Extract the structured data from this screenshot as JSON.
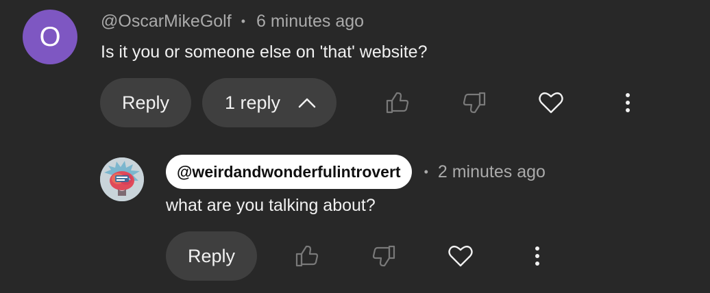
{
  "comment": {
    "avatar_letter": "O",
    "avatar_color": "#7e57c2",
    "author": "@OscarMikeGolf",
    "separator": "•",
    "time": "6 minutes ago",
    "text": "Is it you or someone else on 'that' website?",
    "reply_button_label": "Reply",
    "replies_toggle_label": "1 reply",
    "replies_toggle_icon": "chevron-up-icon",
    "like_icon": "thumbs-up-icon",
    "dislike_icon": "thumbs-down-icon",
    "heart_icon": "heart-icon",
    "more_icon": "more-vert-icon"
  },
  "reply": {
    "avatar_icon": "brain-avatar",
    "author": "@weirdandwonderfulintrovert",
    "separator": "•",
    "time": "2 minutes ago",
    "text": "what are you talking about?",
    "reply_button_label": "Reply",
    "like_icon": "thumbs-up-icon",
    "dislike_icon": "thumbs-down-icon",
    "heart_icon": "heart-icon",
    "more_icon": "more-vert-icon"
  },
  "colors": {
    "background": "#282828",
    "pill": "#3f3f3f",
    "text": "#f1f1f1",
    "secondary_text": "#aaaaaa",
    "icon_dim": "#7a7a7a"
  }
}
